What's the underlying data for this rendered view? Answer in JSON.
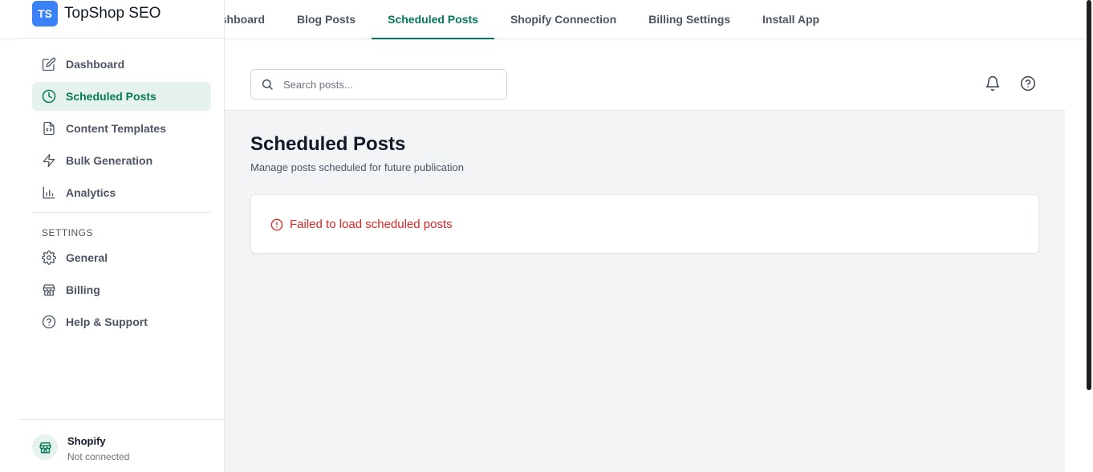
{
  "brand": {
    "logo_text": "TS",
    "name": "TopShop SEO"
  },
  "tabs": [
    {
      "label": "Dashboard"
    },
    {
      "label": "Blog Posts"
    },
    {
      "label": "Scheduled Posts"
    },
    {
      "label": "Shopify Connection"
    },
    {
      "label": "Billing Settings"
    },
    {
      "label": "Install App"
    }
  ],
  "sidebar": {
    "items": [
      {
        "label": "Dashboard",
        "icon": "edit-icon"
      },
      {
        "label": "Scheduled Posts",
        "icon": "clock-icon"
      },
      {
        "label": "Content Templates",
        "icon": "file-code-icon"
      },
      {
        "label": "Bulk Generation",
        "icon": "lightning-icon"
      },
      {
        "label": "Analytics",
        "icon": "bar-chart-icon"
      }
    ],
    "settings_label": "SETTINGS",
    "settings_items": [
      {
        "label": "General",
        "icon": "gear-icon"
      },
      {
        "label": "Billing",
        "icon": "store-icon"
      },
      {
        "label": "Help & Support",
        "icon": "help-circle-icon"
      }
    ],
    "footer": {
      "name": "Shopify",
      "status": "Not connected",
      "icon": "store-icon"
    }
  },
  "header": {
    "search_placeholder": "Search posts...",
    "search_value": ""
  },
  "main": {
    "title": "Scheduled Posts",
    "subtitle": "Manage posts scheduled for future publication",
    "error": "Failed to load scheduled posts"
  },
  "colors": {
    "accent": "#047857",
    "accent_bg": "#e6f2ec",
    "error": "#dc2626",
    "logo": "#3b82f6"
  }
}
